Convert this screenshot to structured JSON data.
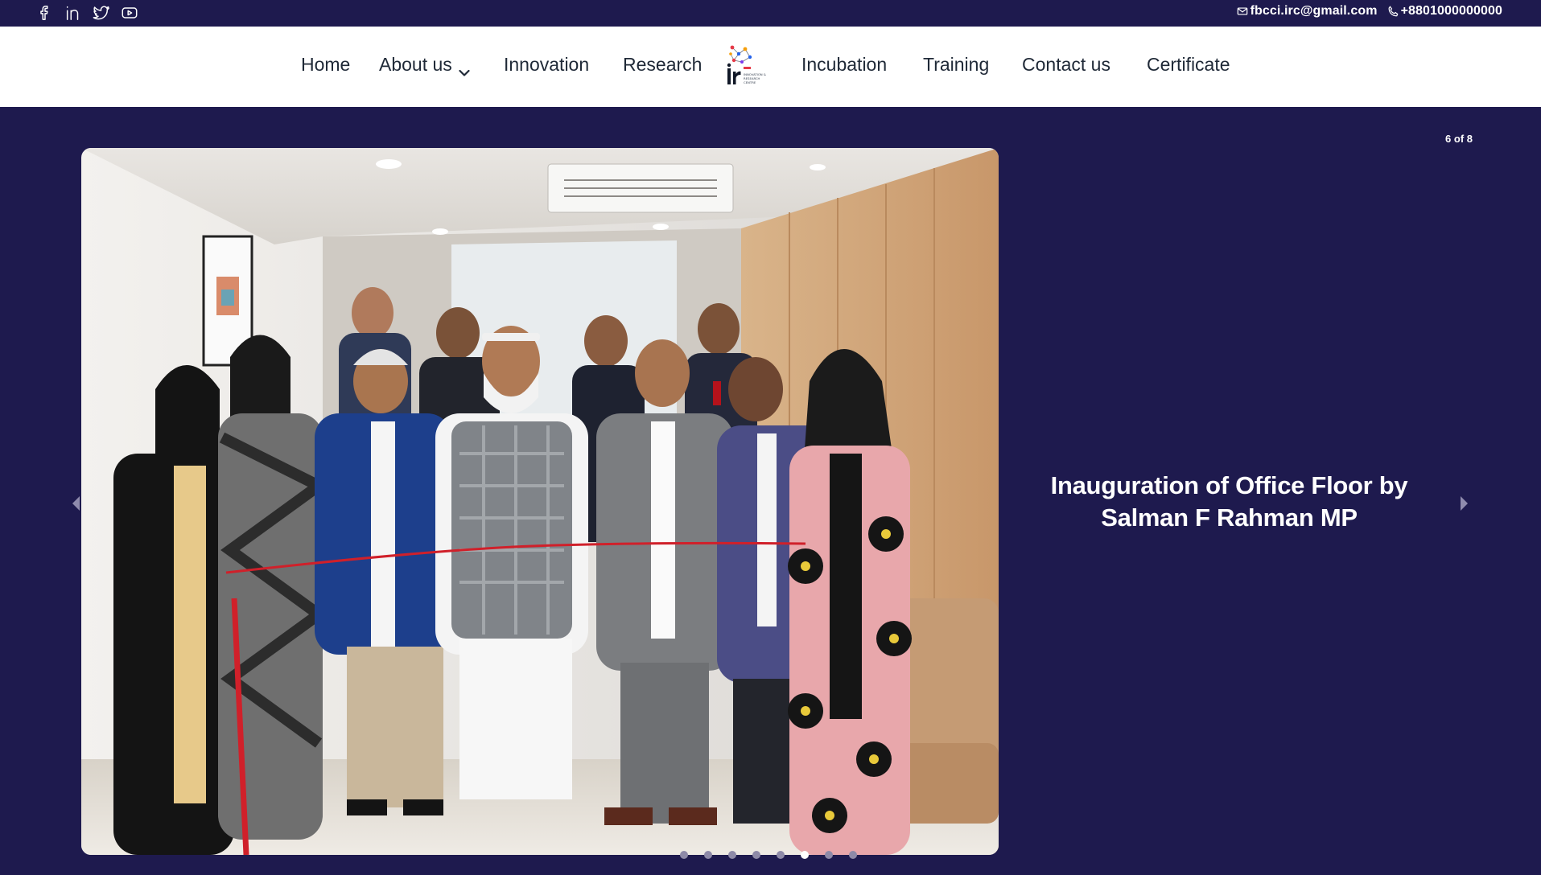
{
  "topbar": {
    "social": [
      {
        "icon": "facebook-icon"
      },
      {
        "icon": "linkedin-icon"
      },
      {
        "icon": "twitter-icon"
      },
      {
        "icon": "youtube-icon"
      }
    ],
    "email": "fbcci.irc@gmail.com",
    "phone": "+8801000000000"
  },
  "nav": {
    "items_left": [
      "Home",
      "About us",
      "Innovation",
      "Research"
    ],
    "items_right": [
      "Incubation",
      "Training",
      "Contact us",
      "Certificate"
    ],
    "logo_text": [
      "INNOVATION &",
      "RESEARCH",
      "CENTRE"
    ]
  },
  "slider": {
    "counter": "6 of 8",
    "caption": "Inauguration of Office Floor by Salman F Rahman MP",
    "total_slides": 8,
    "active_index": 6
  },
  "colors": {
    "topbar_bg": "#1e1a4e",
    "hero_bg": "#1e1a4e",
    "nav_text": "#1f2937",
    "white": "#ffffff"
  }
}
